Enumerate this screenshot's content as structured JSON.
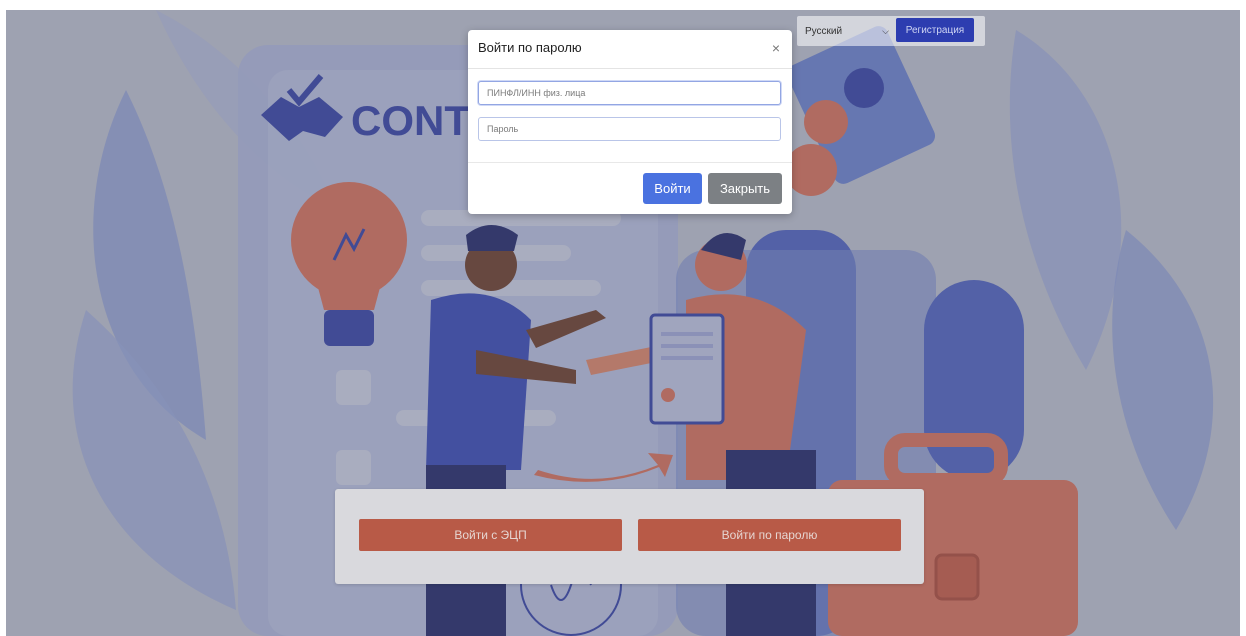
{
  "topbar": {
    "language": "Русский",
    "register_label": "Регистрация"
  },
  "background": {
    "logo_text": "CONT"
  },
  "login_panel": {
    "ecp_button_label": "Войти с ЭЦП",
    "password_button_label": "Войти по паролю"
  },
  "modal": {
    "title": "Войти по паролю",
    "close_symbol": "×",
    "login_placeholder": "ПИНФЛ/ИНН физ. лица",
    "password_placeholder": "Пароль",
    "submit_label": "Войти",
    "cancel_label": "Закрыть"
  },
  "colors": {
    "brand_blue": "#2d3db0",
    "accent_red": "#e0664f",
    "primary_button": "#4a72e0"
  }
}
